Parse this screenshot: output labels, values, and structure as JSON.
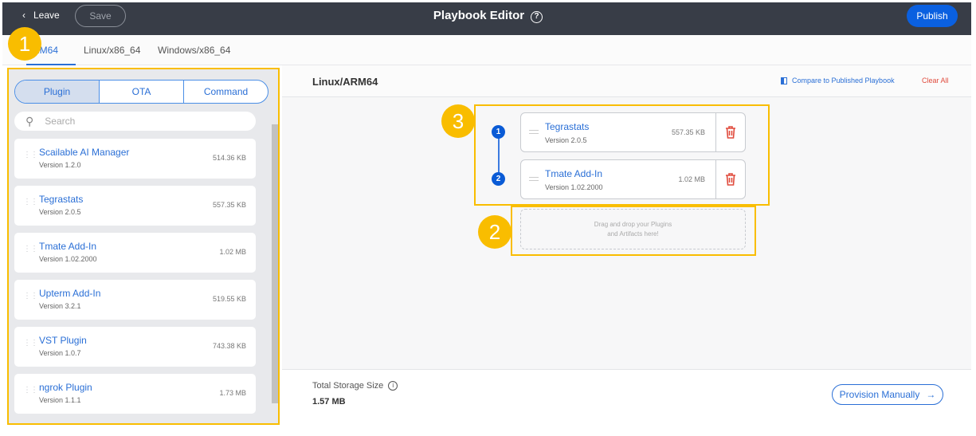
{
  "header": {
    "leave": "Leave",
    "save": "Save",
    "title": "Playbook Editor",
    "help_icon": "?",
    "publish": "Publish"
  },
  "tabs": [
    "Linux/ARM64",
    "Linux/x86_64",
    "Windows/x86_64"
  ],
  "tab_visible0": "ARM64",
  "library": {
    "segments": [
      "Plugin",
      "OTA",
      "Command"
    ],
    "search_placeholder": "Search",
    "items": [
      {
        "name": "Scailable AI Manager",
        "version": "Version 1.2.0",
        "size": "514.36 KB"
      },
      {
        "name": "Tegrastats",
        "version": "Version 2.0.5",
        "size": "557.35 KB"
      },
      {
        "name": "Tmate Add-In",
        "version": "Version 1.02.2000",
        "size": "1.02 MB"
      },
      {
        "name": "Upterm Add-In",
        "version": "Version 3.2.1",
        "size": "519.55 KB"
      },
      {
        "name": "VST Plugin",
        "version": "Version 1.0.7",
        "size": "743.38 KB"
      },
      {
        "name": "ngrok Plugin",
        "version": "Version 1.1.1",
        "size": "1.73 MB"
      }
    ]
  },
  "main": {
    "title": "Linux/ARM64",
    "compare": "Compare to Published Playbook",
    "clear": "Clear All",
    "steps": [
      {
        "n": "1",
        "name": "Tegrastats",
        "version": "Version 2.0.5",
        "size": "557.35 KB"
      },
      {
        "n": "2",
        "name": "Tmate Add-In",
        "version": "Version 1.02.2000",
        "size": "1.02 MB"
      }
    ],
    "drop_line1": "Drag and drop your Plugins",
    "drop_line2": "and Artifacts here!"
  },
  "footer": {
    "label": "Total Storage Size",
    "value": "1.57 MB",
    "provision": "Provision Manually"
  },
  "annotations": [
    "1",
    "2",
    "3"
  ],
  "colors": {
    "accent": "#2a6fd6",
    "header": "#383d47",
    "publish": "#0a60e0",
    "annotation": "#f9bd00",
    "danger": "#e04b3d"
  }
}
